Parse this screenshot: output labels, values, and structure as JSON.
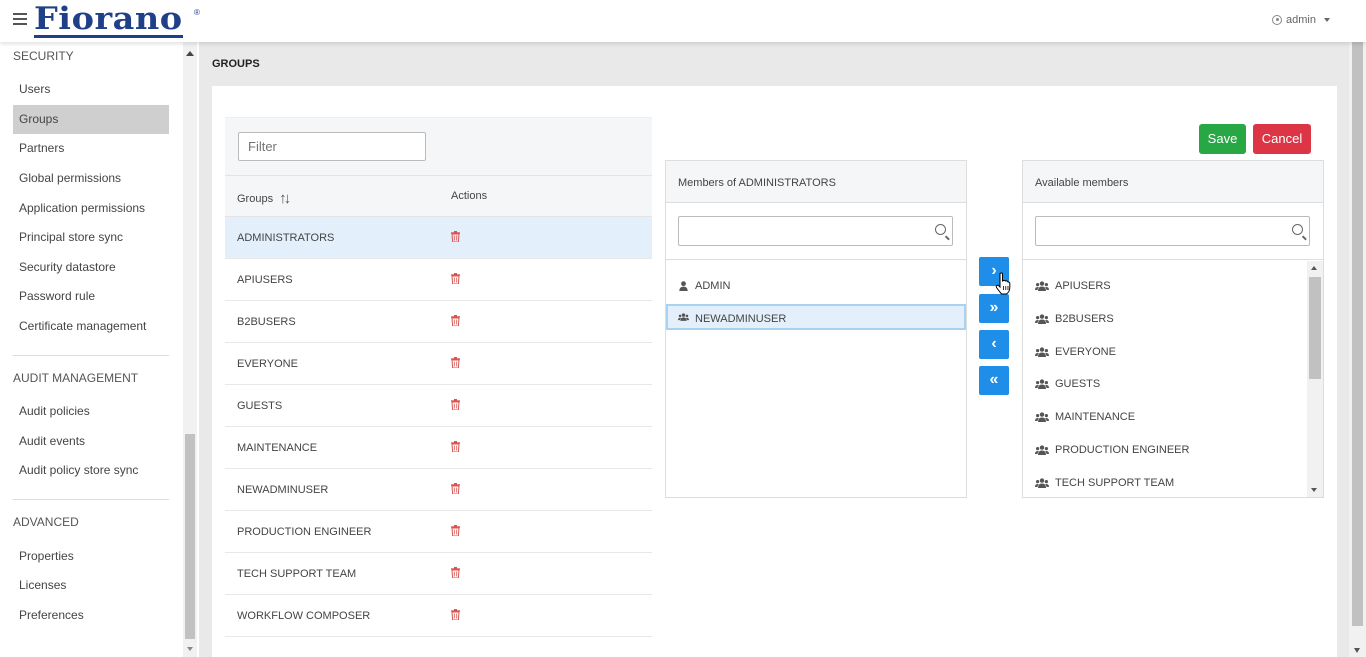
{
  "brand": {
    "logo_text": "Fiorano",
    "registered": "®"
  },
  "user_menu": {
    "label": "admin"
  },
  "sidebar": {
    "sections": [
      {
        "title": "SECURITY"
      },
      {
        "title": "AUDIT MANAGEMENT"
      },
      {
        "title": "ADVANCED"
      }
    ],
    "security_items": [
      "Users",
      "Groups",
      "Partners",
      "Global permissions",
      "Application permissions",
      "Principal store sync",
      "Security datastore",
      "Password rule",
      "Certificate management"
    ],
    "audit_items": [
      "Audit policies",
      "Audit events",
      "Audit policy store sync"
    ],
    "advanced_items": [
      "Properties",
      "Licenses",
      "Preferences"
    ],
    "active_item": "Groups"
  },
  "page": {
    "title": "GROUPS"
  },
  "groups_table": {
    "filter_placeholder": "Filter",
    "col_groups": "Groups",
    "col_actions": "Actions",
    "rows": [
      "ADMINISTRATORS",
      "APIUSERS",
      "B2BUSERS",
      "EVERYONE",
      "GUESTS",
      "MAINTENANCE",
      "NEWADMINUSER",
      "PRODUCTION ENGINEER",
      "TECH SUPPORT TEAM",
      "WORKFLOW COMPOSER"
    ],
    "selected_row": "ADMINISTRATORS"
  },
  "members_panel": {
    "title": "Members of ADMINISTRATORS",
    "items": [
      {
        "name": "ADMIN",
        "icon": "user-icon"
      },
      {
        "name": "NEWADMINUSER",
        "icon": "users-icon"
      }
    ],
    "selected": "NEWADMINUSER"
  },
  "available_panel": {
    "title": "Available members",
    "items": [
      "APIUSERS",
      "B2BUSERS",
      "EVERYONE",
      "GUESTS",
      "MAINTENANCE",
      "PRODUCTION ENGINEER",
      "TECH SUPPORT TEAM"
    ]
  },
  "transfer_buttons": {
    "move_one_right": "›",
    "move_all_right": "»",
    "move_one_left": "‹",
    "move_all_left": "«"
  },
  "actions": {
    "save_label": "Save",
    "cancel_label": "Cancel"
  },
  "colors": {
    "brand": "#1f3f88",
    "primary": "#1e8ee8",
    "save": "#28a745",
    "cancel": "#dc3545",
    "trash": "#d9534f",
    "selection": "#e3f0fb"
  }
}
